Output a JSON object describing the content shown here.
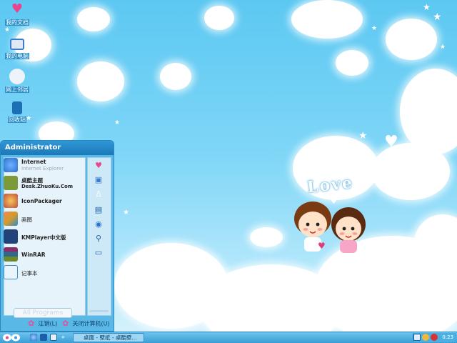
{
  "desktop_icons": [
    {
      "label": "我的文档",
      "icon": "heart-icon",
      "color": "#e8448f"
    },
    {
      "label": "我的电脑",
      "icon": "computer-icon",
      "color": "#3b7bd0"
    },
    {
      "label": "网上邻居",
      "icon": "network-bunny-icon",
      "color": "#d8e4f0"
    },
    {
      "label": "回收站",
      "icon": "recycle-bin-icon",
      "color": "#1b6fb5"
    }
  ],
  "love_text": "Love",
  "start_menu": {
    "user": "Administrator",
    "items": [
      {
        "title": "Internet",
        "subtitle": "Internet Explorer",
        "icon": "ie-icon",
        "color": "#2a6fd0"
      },
      {
        "title": "桌酷主题",
        "subtitle": "Desk.ZhuoKu.Com",
        "icon": "zhuoku-theme-icon",
        "color": "#7d9a3a"
      },
      {
        "title": "IconPackager",
        "subtitle": "",
        "icon": "iconpackager-icon",
        "color": "#c84a3a"
      },
      {
        "title": "画图",
        "subtitle": "",
        "icon": "paint-icon",
        "color": "#d39b2b"
      },
      {
        "title": "KMPlayer中文版",
        "subtitle": "",
        "icon": "kmplayer-icon",
        "color": "#22427a"
      },
      {
        "title": "WinRAR",
        "subtitle": "",
        "icon": "winrar-icon",
        "color": "#8a2d6b"
      },
      {
        "title": "记事本",
        "subtitle": "",
        "icon": "notepad-icon",
        "color": "#3a8fd6"
      }
    ],
    "right_icons": [
      "heart-icon",
      "computer-icon",
      "bunny-icon",
      "control-panel-icon",
      "internet-icon",
      "search-icon",
      "run-icon"
    ],
    "all_programs": "All Programs",
    "logoff": "注销(L)",
    "shutdown": "关闭计算机(U)"
  },
  "taskbar": {
    "task_label": "桌面 - 壁纸 - 桌酷壁...",
    "clock": "0:23"
  }
}
